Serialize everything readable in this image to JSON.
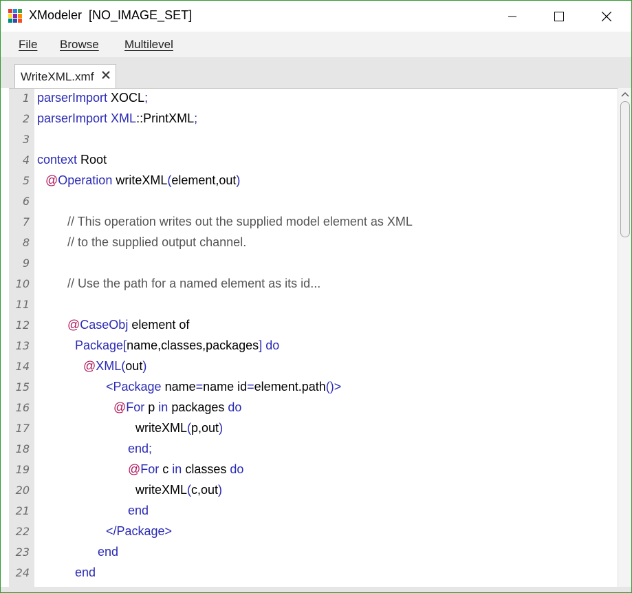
{
  "window": {
    "title": "XModeler  [NO_IMAGE_SET]",
    "icon_colors": [
      "#e53935",
      "#1e88e5",
      "#43a047",
      "#fdd835",
      "#8e24aa",
      "#fb8c00",
      "#00897b",
      "#3949ab",
      "#f4511e"
    ],
    "controls": {
      "minimize": "minimize-icon",
      "maximize": "maximize-icon",
      "close": "close-icon"
    }
  },
  "menubar": {
    "items": [
      "File",
      "Browse",
      "Multilevel"
    ]
  },
  "tabs": [
    {
      "label": "WriteXML.xmf",
      "close_icon": "close-icon"
    }
  ],
  "editor": {
    "colors": {
      "keyword": "#2a2ab5",
      "annotation": "#b0175a",
      "comment": "#555555",
      "text": "#000000"
    },
    "lines": [
      {
        "n": "1",
        "indent": 0,
        "spans": [
          {
            "t": "parserImport",
            "c": "kw"
          },
          {
            "t": " XOCL",
            "c": ""
          },
          {
            "t": ";",
            "c": "kw"
          }
        ]
      },
      {
        "n": "2",
        "indent": 0,
        "spans": [
          {
            "t": "parserImport",
            "c": "kw"
          },
          {
            "t": " XML",
            "c": "kw"
          },
          {
            "t": "::PrintXML",
            "c": ""
          },
          {
            "t": ";",
            "c": "kw"
          }
        ]
      },
      {
        "n": "3",
        "indent": 0,
        "spans": []
      },
      {
        "n": "4",
        "indent": 0,
        "spans": [
          {
            "t": "context",
            "c": "kw"
          },
          {
            "t": " Root",
            "c": ""
          }
        ]
      },
      {
        "n": "5",
        "indent": 12,
        "spans": [
          {
            "t": "@",
            "c": "at"
          },
          {
            "t": "Operation",
            "c": "kw"
          },
          {
            "t": " writeXML",
            "c": ""
          },
          {
            "t": "(",
            "c": "kw"
          },
          {
            "t": "element,out",
            "c": ""
          },
          {
            "t": ")",
            "c": "kw"
          }
        ]
      },
      {
        "n": "6",
        "indent": 0,
        "spans": []
      },
      {
        "n": "7",
        "indent": 44,
        "spans": [
          {
            "t": "// This operation writes out the supplied model element as XML",
            "c": "cm"
          }
        ]
      },
      {
        "n": "8",
        "indent": 44,
        "spans": [
          {
            "t": "// to the supplied output channel.",
            "c": "cm"
          }
        ]
      },
      {
        "n": "9",
        "indent": 0,
        "spans": []
      },
      {
        "n": "10",
        "indent": 44,
        "spans": [
          {
            "t": "// Use the path for a named element as its id...",
            "c": "cm"
          }
        ]
      },
      {
        "n": "11",
        "indent": 0,
        "spans": []
      },
      {
        "n": "12",
        "indent": 44,
        "spans": [
          {
            "t": "@",
            "c": "at"
          },
          {
            "t": "CaseObj",
            "c": "kw"
          },
          {
            "t": " element of",
            "c": ""
          }
        ]
      },
      {
        "n": "13",
        "indent": 55,
        "spans": [
          {
            "t": "Package",
            "c": "kw"
          },
          {
            "t": "[",
            "c": "kw"
          },
          {
            "t": "name,classes,packages",
            "c": ""
          },
          {
            "t": "]",
            "c": "kw"
          },
          {
            "t": " do",
            "c": "kw"
          }
        ]
      },
      {
        "n": "14",
        "indent": 67,
        "spans": [
          {
            "t": "@",
            "c": "at"
          },
          {
            "t": "XML",
            "c": "kw"
          },
          {
            "t": "(",
            "c": "kw"
          },
          {
            "t": "out",
            "c": ""
          },
          {
            "t": ")",
            "c": "kw"
          }
        ]
      },
      {
        "n": "15",
        "indent": 100,
        "spans": [
          {
            "t": "<Package",
            "c": "kw"
          },
          {
            "t": " name",
            "c": ""
          },
          {
            "t": "=",
            "c": "kw"
          },
          {
            "t": "name id",
            "c": ""
          },
          {
            "t": "=",
            "c": "kw"
          },
          {
            "t": "element.path",
            "c": ""
          },
          {
            "t": "()>",
            "c": "kw"
          }
        ]
      },
      {
        "n": "16",
        "indent": 111,
        "spans": [
          {
            "t": "@",
            "c": "at"
          },
          {
            "t": "For",
            "c": "kw"
          },
          {
            "t": " p ",
            "c": ""
          },
          {
            "t": "in",
            "c": "kw"
          },
          {
            "t": " packages ",
            "c": ""
          },
          {
            "t": "do",
            "c": "kw"
          }
        ]
      },
      {
        "n": "17",
        "indent": 143,
        "spans": [
          {
            "t": "writeXML",
            "c": ""
          },
          {
            "t": "(",
            "c": "kw"
          },
          {
            "t": "p,out",
            "c": ""
          },
          {
            "t": ")",
            "c": "kw"
          }
        ]
      },
      {
        "n": "18",
        "indent": 132,
        "spans": [
          {
            "t": "end;",
            "c": "kw"
          }
        ]
      },
      {
        "n": "19",
        "indent": 132,
        "spans": [
          {
            "t": "@",
            "c": "at"
          },
          {
            "t": "For",
            "c": "kw"
          },
          {
            "t": " c ",
            "c": ""
          },
          {
            "t": "in",
            "c": "kw"
          },
          {
            "t": " classes ",
            "c": ""
          },
          {
            "t": "do",
            "c": "kw"
          }
        ]
      },
      {
        "n": "20",
        "indent": 143,
        "spans": [
          {
            "t": "writeXML",
            "c": ""
          },
          {
            "t": "(",
            "c": "kw"
          },
          {
            "t": "c,out",
            "c": ""
          },
          {
            "t": ")",
            "c": "kw"
          }
        ]
      },
      {
        "n": "21",
        "indent": 132,
        "spans": [
          {
            "t": "end",
            "c": "kw"
          }
        ]
      },
      {
        "n": "22",
        "indent": 100,
        "spans": [
          {
            "t": "</Package>",
            "c": "kw"
          }
        ]
      },
      {
        "n": "23",
        "indent": 88,
        "spans": [
          {
            "t": "end",
            "c": "kw"
          }
        ]
      },
      {
        "n": "24",
        "indent": 55,
        "spans": [
          {
            "t": "end",
            "c": "kw"
          }
        ]
      }
    ]
  },
  "scrollbar": {
    "up_icon": "chevron-up-icon"
  }
}
